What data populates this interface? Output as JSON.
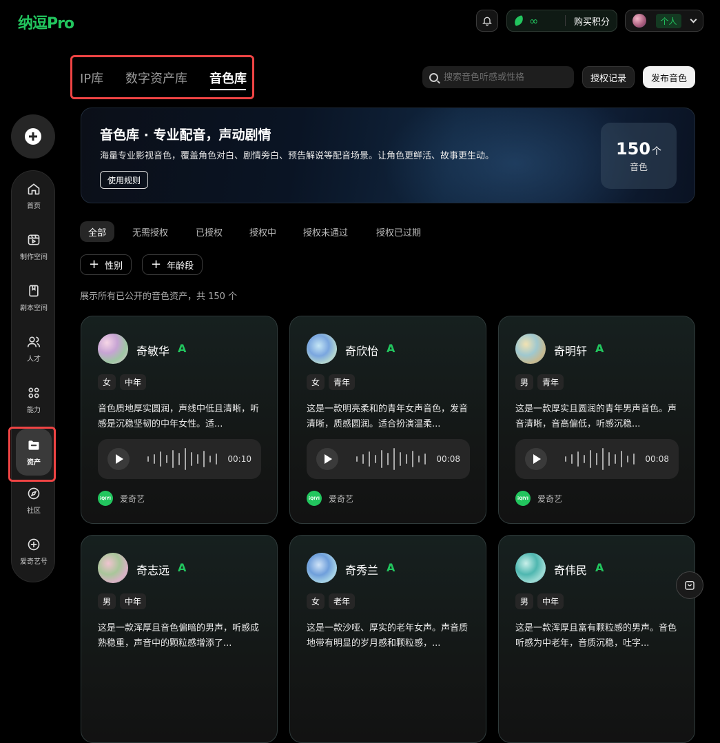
{
  "app": {
    "logo": "纳逗Pro"
  },
  "header": {
    "points_value": "∞",
    "buy_label": "购买积分",
    "user_label": "个人"
  },
  "sidebar": {
    "items": [
      {
        "label": "首页",
        "icon": "home-icon"
      },
      {
        "label": "制作空间",
        "icon": "video-icon"
      },
      {
        "label": "剧本空间",
        "icon": "script-icon"
      },
      {
        "label": "人才",
        "icon": "people-icon"
      },
      {
        "label": "能力",
        "icon": "grid-icon"
      },
      {
        "label": "资产",
        "icon": "folder-icon",
        "active": true
      },
      {
        "label": "社区",
        "icon": "compass-icon"
      },
      {
        "label": "爱奇艺号",
        "icon": "plus-circle-icon"
      }
    ]
  },
  "tabs": [
    {
      "label": "IP库"
    },
    {
      "label": "数字资产库"
    },
    {
      "label": "音色库",
      "active": true
    }
  ],
  "search": {
    "placeholder": "搜索音色听感或性格"
  },
  "toolbar": {
    "auth_record": "授权记录",
    "publish": "发布音色"
  },
  "banner": {
    "title": "音色库 · 专业配音，声动剧情",
    "desc": "海量专业影视音色，覆盖角色对白、剧情旁白、预告解说等配音场景。让角色更鲜活、故事更生动。",
    "rules_button": "使用规则",
    "count_value": "150",
    "count_unit": "个",
    "count_label": "音色"
  },
  "filters": {
    "chips": [
      "全部",
      "无需授权",
      "已授权",
      "授权中",
      "授权未通过",
      "授权已过期"
    ],
    "tags": [
      "性别",
      "年龄段"
    ]
  },
  "summary": "展示所有已公开的音色资产，共 150 个",
  "cards": [
    {
      "name": "奇敏华",
      "grade": "A",
      "tags": [
        "女",
        "中年"
      ],
      "desc": "音色质地厚实圆润，声线中低且清晰，听感是沉稳坚韧的中年女性。适...",
      "duration": "00:10",
      "source": "爱奇艺"
    },
    {
      "name": "奇欣怡",
      "grade": "A",
      "tags": [
        "女",
        "青年"
      ],
      "desc": "这是一款明亮柔和的青年女声音色，发音清晰，质感圆润。适合扮演温柔...",
      "duration": "00:08",
      "source": "爱奇艺"
    },
    {
      "name": "奇明轩",
      "grade": "A",
      "tags": [
        "男",
        "青年"
      ],
      "desc": "这是一款厚实且圆润的青年男声音色。声音清晰，音高偏低，听感沉稳...",
      "duration": "00:08",
      "source": "爱奇艺"
    },
    {
      "name": "奇志远",
      "grade": "A",
      "tags": [
        "男",
        "中年"
      ],
      "desc": "这是一款浑厚且音色偏暗的男声，听感成熟稳重，声音中的颗粒感增添了...",
      "duration": "",
      "source": ""
    },
    {
      "name": "奇秀兰",
      "grade": "A",
      "tags": [
        "女",
        "老年"
      ],
      "desc": "这是一款沙哑、厚实的老年女声。声音质地带有明显的岁月感和颗粒感，...",
      "duration": "",
      "source": ""
    },
    {
      "name": "奇伟民",
      "grade": "A",
      "tags": [
        "男",
        "中年"
      ],
      "desc": "这是一款浑厚且富有颗粒感的男声。音色听感为中老年，音质沉稳，吐字...",
      "duration": "",
      "source": ""
    }
  ],
  "source_logo": "iQIYI",
  "colors": {
    "accent": "#22c55e",
    "highlight": "#ef4444",
    "background": "#000000"
  }
}
